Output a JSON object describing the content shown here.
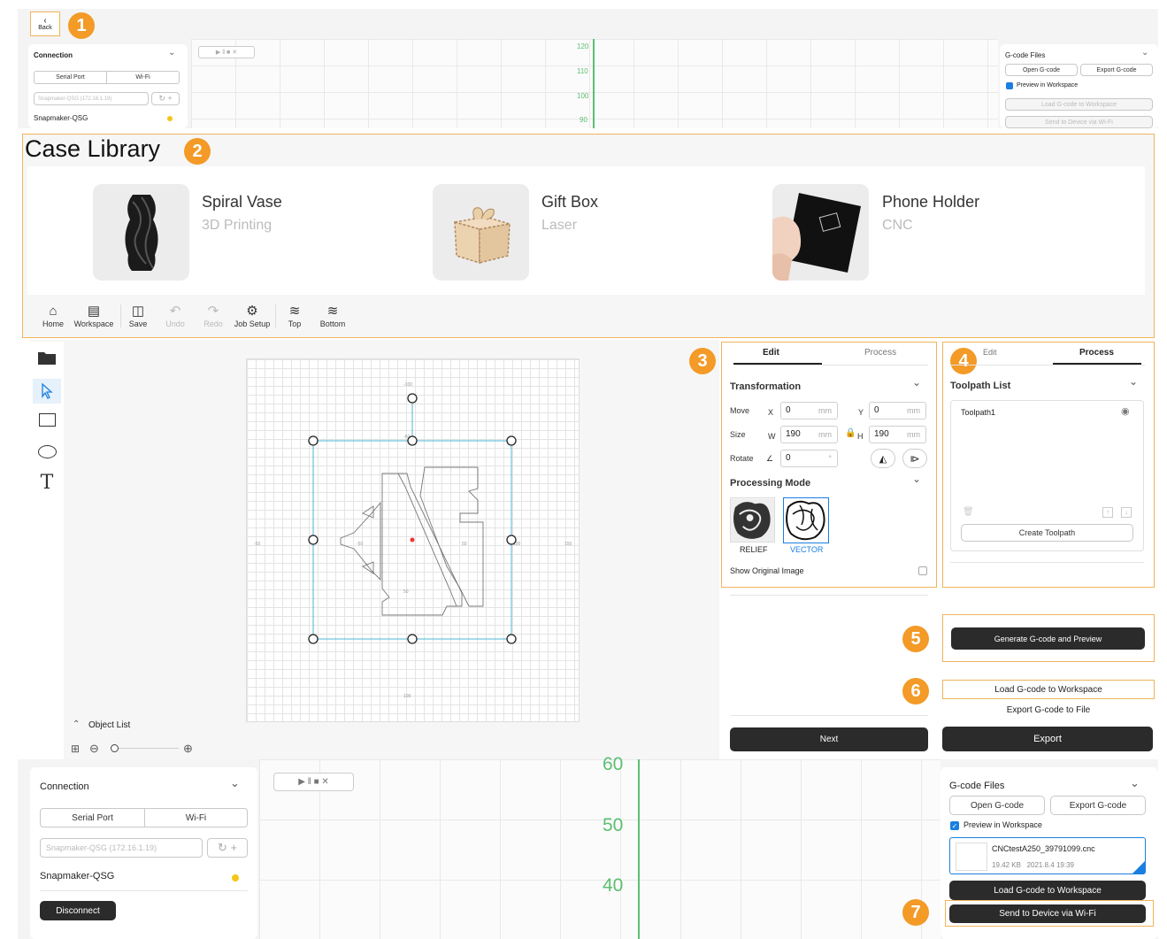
{
  "top": {
    "back_label": "Back",
    "badge1": "1"
  },
  "top_connection": {
    "title": "Connection",
    "tab_serial": "Serial Port",
    "tab_wifi": "Wi-Fi",
    "device_select": "Snapmaker-QSG (172.16.1.19)",
    "device_name": "Snapmaker-QSG"
  },
  "top_ruler": {
    "labels": [
      "120",
      "110",
      "100",
      "90"
    ]
  },
  "top_gcode": {
    "title": "G-code Files",
    "open": "Open G-code",
    "export": "Export G-code",
    "preview": "Preview in Workspace",
    "load": "Load G-code to Workspace",
    "send": "Send to Device via Wi-Fi"
  },
  "case_library": {
    "title": "Case Library",
    "badge": "2",
    "cases": [
      {
        "name": "Spiral Vase",
        "type": "3D Printing"
      },
      {
        "name": "Gift Box",
        "type": "Laser"
      },
      {
        "name": "Phone Holder",
        "type": "CNC"
      }
    ]
  },
  "toolbar": {
    "home": "Home",
    "workspace": "Workspace",
    "save": "Save",
    "undo": "Undo",
    "redo": "Redo",
    "job_setup": "Job Setup",
    "top": "Top",
    "bottom": "Bottom"
  },
  "canvas": {
    "object_list": "Object List",
    "axis": [
      "-50",
      "-50",
      "50",
      "100",
      "150",
      "-100",
      "-50",
      "50",
      "100"
    ]
  },
  "edit_panel": {
    "badge": "3",
    "tab_edit": "Edit",
    "tab_process": "Process",
    "transformation": "Transformation",
    "move_label": "Move",
    "x_label": "X",
    "x_value": "0",
    "y_label": "Y",
    "y_value": "0",
    "unit": "mm",
    "size_label": "Size",
    "w_label": "W",
    "w_value": "190",
    "h_label": "H",
    "h_value": "190",
    "rotate_label": "Rotate",
    "rotate_value": "0",
    "deg": "°",
    "processing_mode": "Processing Mode",
    "mode_relief": "RELIEF",
    "mode_vector": "VECTOR",
    "show_original": "Show Original Image",
    "next": "Next"
  },
  "process_panel": {
    "badge": "4",
    "tab_edit": "Edit",
    "tab_process": "Process",
    "toolpath_list": "Toolpath List",
    "toolpath1": "Toolpath1",
    "create": "Create Toolpath",
    "badge5": "5",
    "generate": "Generate G-code and Preview",
    "badge6": "6",
    "load": "Load G-code to Workspace",
    "export_file": "Export G-code to File",
    "export": "Export"
  },
  "bottom_connection": {
    "title": "Connection",
    "tab_serial": "Serial Port",
    "tab_wifi": "Wi-Fi",
    "device_select": "Snapmaker-QSG (172.16.1.19)",
    "device_name": "Snapmaker-QSG",
    "disconnect": "Disconnect"
  },
  "bottom_ruler": {
    "labels": [
      "60",
      "50",
      "40"
    ]
  },
  "bottom_gcode": {
    "title": "G-code Files",
    "open": "Open G-code",
    "export": "Export G-code",
    "preview": "Preview in Workspace",
    "file_name": "CNCtestA250_39791099.cnc",
    "file_meta": "19.42 KB   2021.8.4 19:39",
    "load": "Load G-code to Workspace",
    "badge7": "7",
    "send": "Send to Device via Wi-Fi"
  },
  "colors": {
    "accent": "#f39a27",
    "dark_button": "#2b2b2b",
    "selection": "#4db6d6",
    "ruler": "#5cbf72",
    "blue": "#1a7fe0"
  }
}
